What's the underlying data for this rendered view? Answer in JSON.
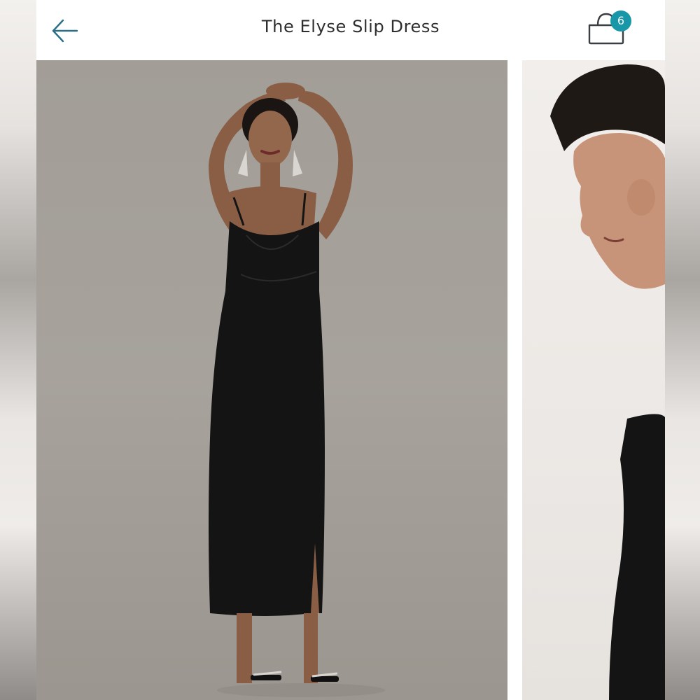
{
  "header": {
    "title": "The Elyse Slip Dress",
    "back_icon": "arrow-left-icon",
    "bag_icon": "shopping-bag-icon",
    "bag_count": "6"
  },
  "colors": {
    "accent": "#1797a7",
    "icon_stroke": "#2b6f86",
    "header_bg": "#ffffff",
    "photo_bg_main": "#a29d97",
    "photo_bg_next": "#eeebe8",
    "dress": "#141414"
  },
  "gallery": {
    "slides": [
      {
        "name": "product-photo-model-full-length"
      },
      {
        "name": "product-photo-model-closeup"
      }
    ]
  }
}
